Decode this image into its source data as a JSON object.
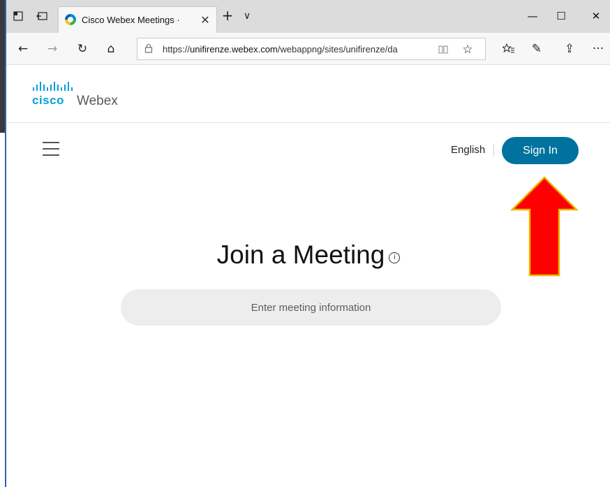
{
  "browser": {
    "tab": {
      "title": "Cisco Webex Meetings ·",
      "close_glyph": "✕"
    },
    "new_tab_glyph": "+",
    "tab_list_glyph": "∨",
    "window_controls": {
      "minimize": "—",
      "maximize": "☐",
      "close": "✕"
    },
    "nav": {
      "back": "←",
      "forward": "→",
      "refresh": "↻",
      "home": "⌂"
    },
    "url": {
      "prefix": "https://",
      "domain": "unifirenze.webex.com",
      "path": "/webappng/sites/unifirenze/da"
    },
    "toolbar": {
      "favorites": "☆",
      "collections": "✰",
      "pen": "✎",
      "share": "⇪",
      "more": "···"
    }
  },
  "page": {
    "logo": {
      "cisco": "cisco",
      "product": "Webex"
    },
    "language": "English",
    "sign_in_label": "Sign In",
    "join_title": "Join a Meeting",
    "info_glyph": "i",
    "meeting_input_placeholder": "Enter meeting information"
  },
  "colors": {
    "brand_blue": "#049fd9",
    "sign_in_bg": "#00729f",
    "annotation_arrow": "#ff0000",
    "annotation_arrow_border": "#e6b800"
  }
}
